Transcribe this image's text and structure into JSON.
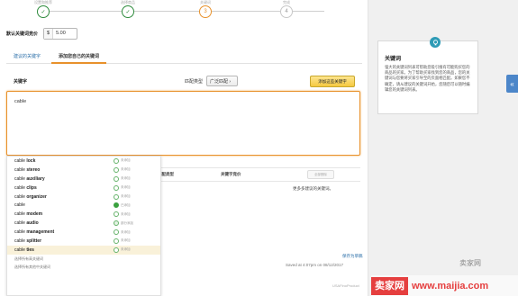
{
  "stepper": {
    "steps": [
      {
        "label": "设置和推荐",
        "state": "done",
        "symbol": "✓"
      },
      {
        "label": "选择商品",
        "state": "done",
        "symbol": "✓"
      },
      {
        "label": "关键词",
        "state": "current",
        "symbol": "3"
      },
      {
        "label": "完成",
        "state": "future",
        "symbol": "4"
      }
    ]
  },
  "bid": {
    "label": "默认关键词竞价",
    "currency": "$",
    "value": "5.00"
  },
  "tabs": [
    {
      "label": "建议的关键字",
      "active": false
    },
    {
      "label": "添加您自己的关键词",
      "active": true
    }
  ],
  "keyword_panel": {
    "header_label": "关键字",
    "match_type_label": "匹配类型",
    "match_type_value": "广泛匹配 ›",
    "add_button": "添加这些关键字",
    "textarea_value": "cable"
  },
  "suggestions": [
    {
      "prefix": "cable",
      "rest": " lock",
      "status": "未添加",
      "state": "none"
    },
    {
      "prefix": "cable",
      "rest": " stereo",
      "status": "未添加",
      "state": "none"
    },
    {
      "prefix": "cable",
      "rest": " auxiliary",
      "status": "未添加",
      "state": "none"
    },
    {
      "prefix": "cable",
      "rest": " clips",
      "status": "未添加",
      "state": "none"
    },
    {
      "prefix": "cable",
      "rest": " organizer",
      "status": "未添加",
      "state": "none"
    },
    {
      "prefix": "cable",
      "rest": "",
      "status": "已添加",
      "state": "added"
    },
    {
      "prefix": "cable",
      "rest": " modem",
      "status": "未添加",
      "state": "none"
    },
    {
      "prefix": "cable",
      "rest": " audio",
      "status": "部分添加",
      "state": "partial"
    },
    {
      "prefix": "cable",
      "rest": " management",
      "status": "未添加",
      "state": "none"
    },
    {
      "prefix": "cable",
      "rest": " splitter",
      "status": "未添加",
      "state": "none"
    },
    {
      "prefix": "cable",
      "rest": " ties",
      "status": "未添加",
      "state": "none",
      "hover": true
    }
  ],
  "suggest_footer": [
    "选择所有高关键词",
    "选择所有其他中关键词"
  ],
  "table": {
    "col_match": "匹配类型",
    "col_bid": "关键字竞价",
    "remove_all": "全部删除",
    "empty_text": "更多多建议的关键词。"
  },
  "save": {
    "link": "保存为草稿",
    "saved_at": "Saved at 4:07pm on 08/12/2017"
  },
  "footer_text": "USAFinoProduct",
  "help": {
    "title": "关键词",
    "body": "强大的关键词列表可帮助您吸引搜有可能购买您的商品的买家。为了帮助买家找到您的商品，您的关键词与您要将买家引导至的页面相匹配。如果您不确定，请从建议的关键词开始，您随后可以随时编辑您的关键词列表。"
  },
  "watermark": {
    "brand": "卖家网",
    "url": "www.maijia.com",
    "wechat": "卖家网"
  },
  "colors": {
    "accent_orange": "#e8912b",
    "done_green": "#2e8b3c",
    "link_blue": "#2a6ea8",
    "handle_blue": "#4c86c9",
    "watermark_red": "#e53f3f"
  }
}
